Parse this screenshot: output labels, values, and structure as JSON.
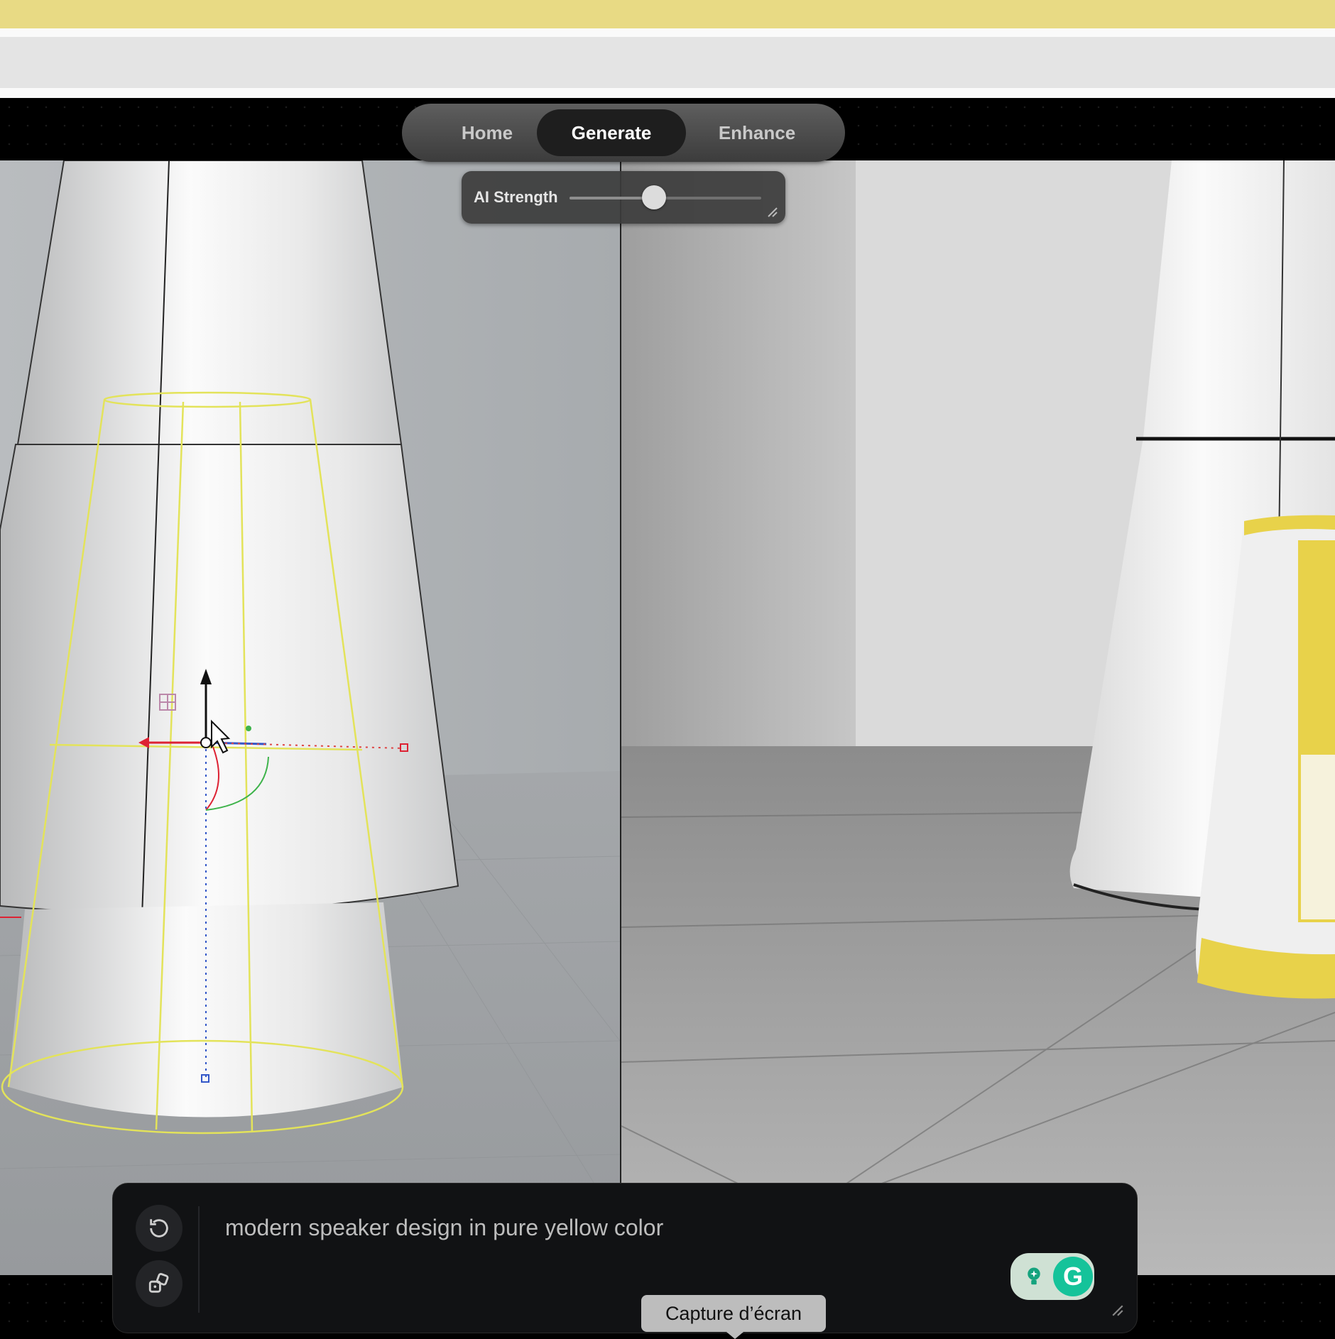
{
  "nav": {
    "tabs": [
      {
        "label": "Home"
      },
      {
        "label": "Generate",
        "active": true
      },
      {
        "label": "Enhance"
      }
    ]
  },
  "ai_strength": {
    "label": "AI Strength",
    "value_fraction": 0.44
  },
  "prompt": {
    "text": "modern speaker design in pure yellow color"
  },
  "tooltip": {
    "text": "Capture d’écran"
  },
  "icons": {
    "reset": "rotate-ccw-icon",
    "dice": "dice-icon",
    "grammarly": "grammarly-icon",
    "lightbulb": "lightbulb-icon"
  },
  "colors": {
    "accent_yellow": "#e8d24a",
    "top_band": "#e8da84",
    "grammarly_green": "#15c39a"
  }
}
